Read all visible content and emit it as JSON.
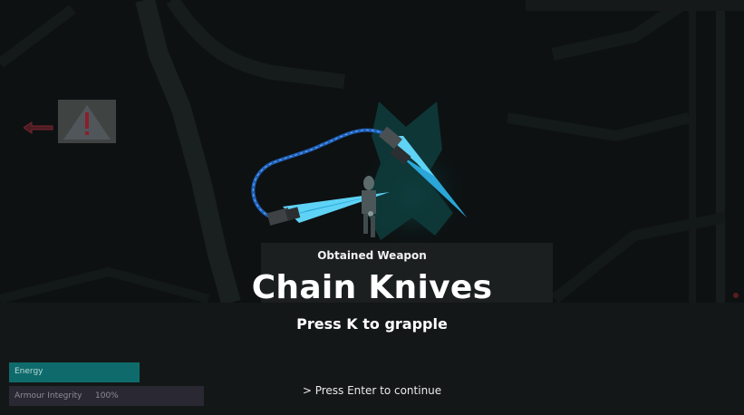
{
  "popup": {
    "subtitle": "Obtained Weapon",
    "title": "Chain Knives",
    "hint": "Press K to grapple",
    "continue": "> Press Enter to continue"
  },
  "hud": {
    "energy": {
      "label": "Energy",
      "fraction": 1.0,
      "color": "#0f6b6b"
    },
    "armour": {
      "label": "Armour Integrity",
      "value": "100%",
      "fraction": 1.0,
      "color": "#292833"
    }
  },
  "icons": [
    "warning-icon",
    "left-arrow-icon",
    "chain-knives-icon",
    "player-character-icon"
  ],
  "colors": {
    "blade": "#5fd3f5",
    "chain": "#1e5fb5",
    "glow": "#0f4a4a",
    "warning": "#8a1f2a"
  }
}
